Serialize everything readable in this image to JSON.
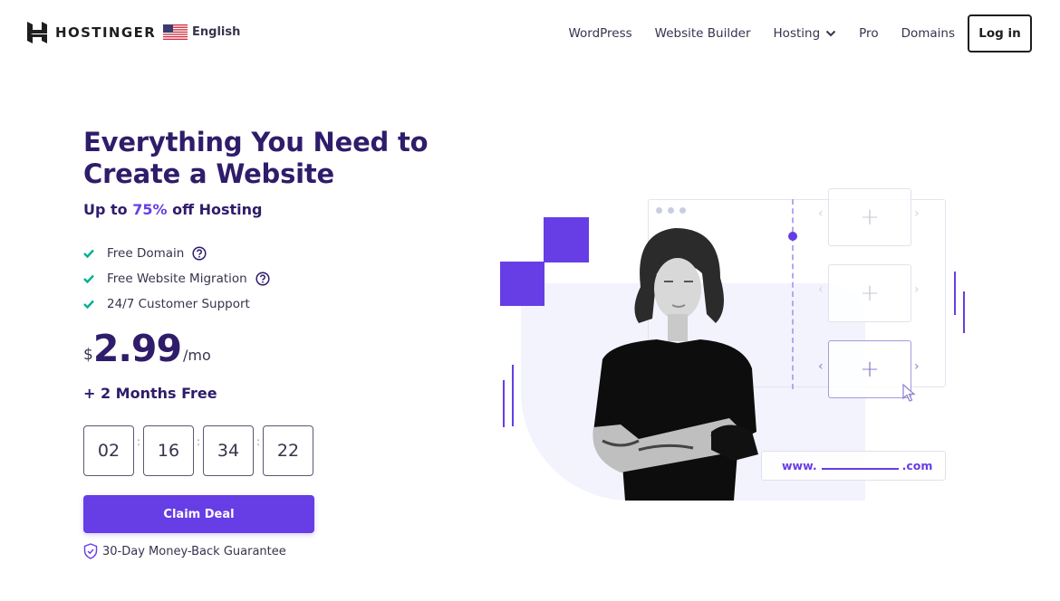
{
  "header": {
    "brand": "HOSTINGER",
    "language": "English",
    "nav": [
      {
        "label": "WordPress"
      },
      {
        "label": "Website Builder"
      },
      {
        "label": "Hosting",
        "has_dropdown": true
      },
      {
        "label": "Pro"
      },
      {
        "label": "Domains"
      }
    ],
    "login_label": "Log in"
  },
  "hero": {
    "title_line1": "Everything You Need to",
    "title_line2": "Create a Website",
    "subtitle_prefix": "Up to ",
    "subtitle_accent": "75%",
    "subtitle_suffix": " off Hosting",
    "features": [
      {
        "label": "Free Domain",
        "has_help": true
      },
      {
        "label": "Free Website Migration",
        "has_help": true
      },
      {
        "label": "24/7 Customer Support",
        "has_help": false
      }
    ],
    "price": {
      "currency": "$",
      "amount": "2.99",
      "period": "/mo"
    },
    "bonus": "+ 2 Months Free",
    "countdown": [
      "02",
      "16",
      "34",
      "22"
    ],
    "countdown_separator": ":",
    "cta_label": "Claim Deal",
    "guarantee": "30-Day Money-Back Guarantee"
  },
  "illustration": {
    "domain_prefix": "www.",
    "domain_suffix": ".com",
    "card_plus": "+",
    "arrow_left": "‹",
    "arrow_right": "›"
  },
  "colors": {
    "accent": "#673de6",
    "heading": "#2f1c6a",
    "check": "#00b090",
    "text": "#36344d"
  }
}
